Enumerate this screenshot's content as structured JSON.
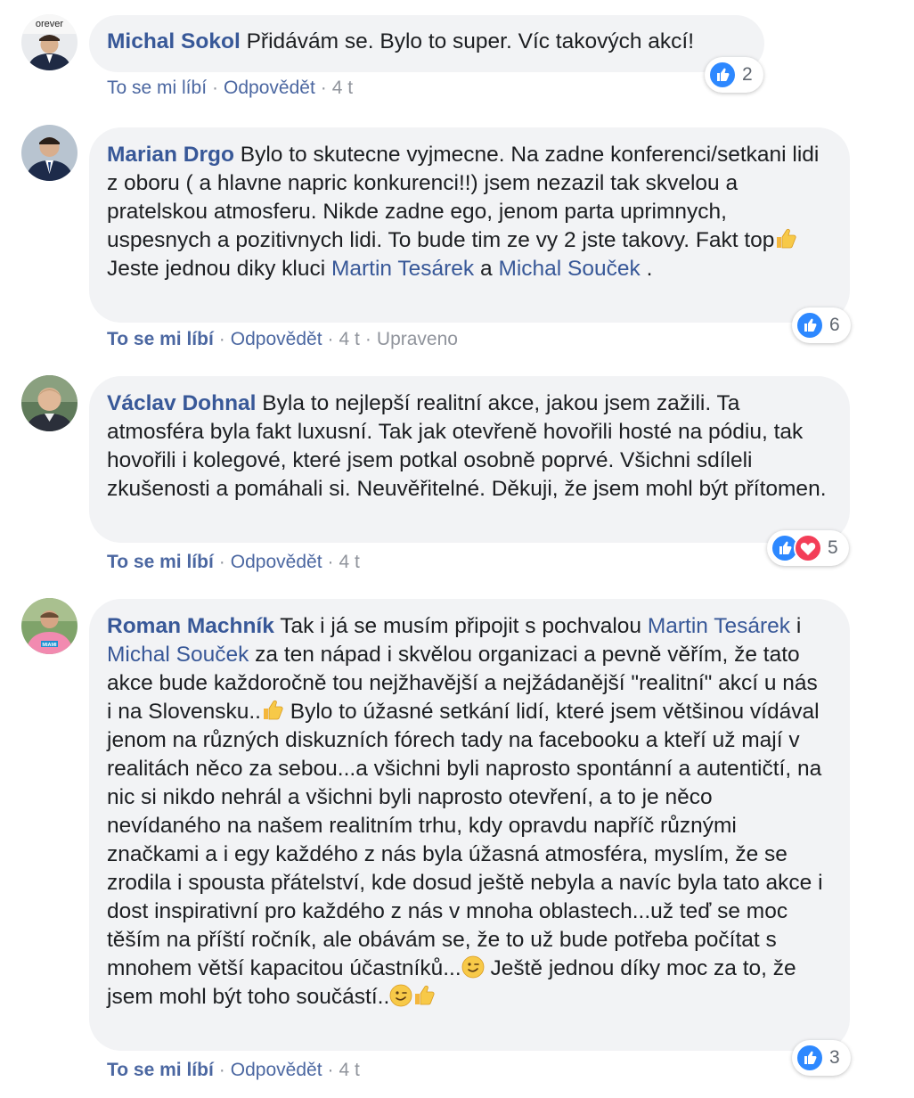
{
  "colors": {
    "link": "#385898",
    "action_link": "#4b67a1",
    "muted": "#90949c",
    "bubble_bg": "#f2f3f5",
    "like_blue": "#2d88ff",
    "love_red": "#f33e58"
  },
  "labels": {
    "like": "To se mi líbí",
    "reply": "Odpovědět",
    "separator": "·",
    "edited": "Upraveno"
  },
  "comments": [
    {
      "author": "Michal Sokol",
      "avatar_text": "orever",
      "text_parts": [
        " Přidávám se. Bylo to super. Víc takových akcí!"
      ],
      "time": "4 t",
      "reactions": {
        "icons": [
          "like-icon"
        ],
        "count": "2"
      }
    },
    {
      "author": "Marian Drgo",
      "text_parts": [
        " Bylo to skutecne vyjmecne. Na zadne konferenci/setkani lidi z oboru ( a hlavne napric konkurenci!!) jsem nezazil tak skvelou a pratelskou atmosferu. Nikde zadne ego, jenom parta uprimnych, uspesnych a pozitivnych lidi. To bude tim ze vy 2 jste takovy. Fakt top",
        " Jeste jednou diky kluci ",
        "Martin Tesárek",
        " a ",
        "Michal Souček",
        " ."
      ],
      "time": "4 t",
      "edited": true,
      "reactions": {
        "icons": [
          "like-icon"
        ],
        "count": "6"
      }
    },
    {
      "author": "Václav Dohnal",
      "text_parts": [
        " Byla to nejlepší realitní akce, jakou jsem zažili. Ta atmosféra byla fakt luxusní. Tak jak otevřeně hovořili hosté na pódiu, tak hovořili i kolegové, které jsem potkal osobně poprvé. Všichni sdíleli zkušenosti a pomáhali si. Neuvěřitelné. Děkuji, že jsem mohl být přítomen."
      ],
      "time": "4 t",
      "reactions": {
        "icons": [
          "like-icon",
          "love-icon"
        ],
        "count": "5"
      }
    },
    {
      "author": "Roman Machník",
      "text_parts": [
        " Tak i já se musím připojit s pochvalou ",
        "Martin Tesárek",
        " i ",
        "Michal Souček",
        " za ten nápad i skvělou organizaci a pevně věřím, že tato akce bude každoročně tou nejžhavější a nejžádanější \"realitní\" akcí u nás i na Slovensku..",
        " Bylo to úžasné setkání lidí, které jsem většinou vídával jenom na různých diskuzních fórech tady na facebooku a kteří už mají v realitách něco za sebou...a všichni byli naprosto spontánní a autentičtí, na nic si nikdo nehrál a všichni byli naprosto otevření, a to je něco nevídaného na našem realitním trhu, kdy opravdu napříč různými značkami a i egy každého z nás byla úžasná atmosféra, myslím, že se zrodila i spousta přátelství, kde dosud ještě nebyla a navíc byla tato akce i dost inspirativní pro každého z nás v mnoha oblastech...už teď se moc těším na příští ročník, ale obávám se, že to už bude potřeba počítat s mnohem větší kapacitou účastníků...",
        " Ještě jednou díky moc za to, že jsem mohl být toho součástí..",
        "avatar_text_miami"
      ],
      "avatar_text": "MIAMI",
      "time": "4 t",
      "reactions": {
        "icons": [
          "like-icon"
        ],
        "count": "3"
      }
    }
  ]
}
